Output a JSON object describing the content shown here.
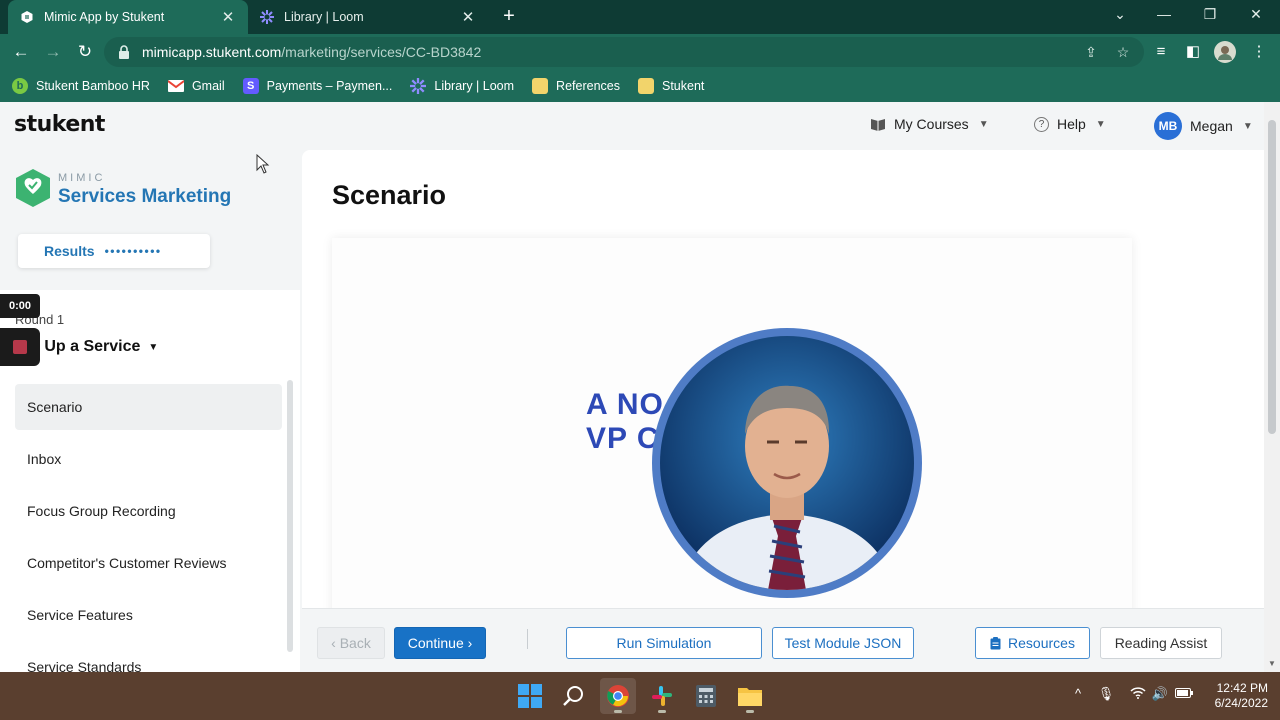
{
  "browser": {
    "tabs": [
      {
        "title": "Mimic App by Stukent",
        "active": true
      },
      {
        "title": "Library | Loom",
        "active": false
      }
    ],
    "url_host": "mimicapp.stukent.com",
    "url_path": "/marketing/services/CC-BD3842",
    "bookmarks": [
      {
        "label": "Stukent Bamboo HR",
        "icon": "bamboo-icon",
        "color": "#7ac943"
      },
      {
        "label": "Gmail",
        "icon": "gmail-icon",
        "color": "#ea4335"
      },
      {
        "label": "Payments – Paymen...",
        "icon": "stripe-icon",
        "color": "#635bff"
      },
      {
        "label": "Library | Loom",
        "icon": "loom-icon",
        "color": "#625df5"
      },
      {
        "label": "References",
        "icon": "folder-icon",
        "color": "#f2d46b"
      },
      {
        "label": "Stukent",
        "icon": "folder-icon",
        "color": "#f2d46b"
      }
    ]
  },
  "app": {
    "logo": "stukent",
    "header": {
      "my_courses": "My Courses",
      "help": "Help",
      "user_initials": "MB",
      "user_name": "Megan"
    },
    "sidebar": {
      "mimic_label": "MIMIC",
      "course_title": "Services Marketing",
      "results_label": "Results",
      "results_dots": "••••••••••",
      "round_label": "Round 1",
      "module_title": "Set Up a Service",
      "items": [
        {
          "label": "Scenario",
          "active": true
        },
        {
          "label": "Inbox",
          "active": false
        },
        {
          "label": "Focus Group Recording",
          "active": false
        },
        {
          "label": "Competitor's Customer Reviews",
          "active": false
        },
        {
          "label": "Service Features",
          "active": false
        },
        {
          "label": "Service Standards",
          "active": false
        }
      ]
    },
    "recorder": {
      "timer": "0:00"
    },
    "main": {
      "page_title": "Scenario",
      "video_text_line1": "A NO",
      "video_text_line2": "VP C"
    },
    "footer": {
      "back": "‹ Back",
      "continue": "Continue ›",
      "run_simulation": "Run Simulation",
      "test_module_json": "Test Module JSON",
      "resources": "Resources",
      "reading_assist": "Reading Assist"
    }
  },
  "taskbar": {
    "time": "12:42 PM",
    "date": "6/24/2022"
  },
  "colors": {
    "chrome_dark": "#0e3b34",
    "chrome": "#1e6b59",
    "accent_blue": "#2476b4",
    "button_blue": "#1872c6",
    "taskbar": "#5a3f2f"
  }
}
